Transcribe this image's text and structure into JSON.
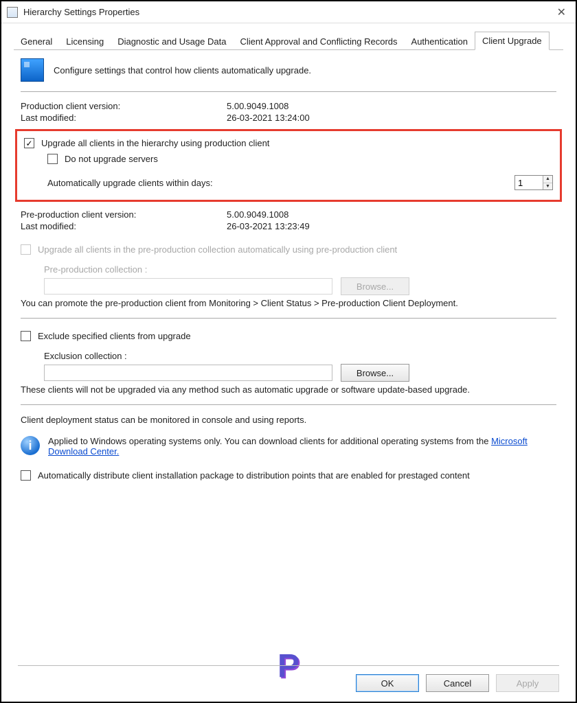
{
  "window": {
    "title": "Hierarchy Settings Properties",
    "close": "✕"
  },
  "tabs": {
    "items": [
      "General",
      "Licensing",
      "Diagnostic and Usage Data",
      "Client Approval and Conflicting Records",
      "Authentication",
      "Client Upgrade"
    ],
    "active": 5
  },
  "intro": "Configure settings that control how clients automatically upgrade.",
  "prod": {
    "version_label": "Production client version:",
    "version_value": "5.00.9049.1008",
    "modified_label": "Last modified:",
    "modified_value": "26-03-2021 13:24:00"
  },
  "upgrade": {
    "all_label": "Upgrade all clients in the hierarchy using production client",
    "all_checked": true,
    "noservers_label": "Do not upgrade servers",
    "noservers_checked": false,
    "days_label": "Automatically upgrade clients within days:",
    "days_value": "1"
  },
  "preprod": {
    "version_label": "Pre-production client version:",
    "version_value": "5.00.9049.1008",
    "modified_label": "Last modified:",
    "modified_value": "26-03-2021 13:23:49",
    "upgrade_label": "Upgrade all clients in the pre-production collection automatically using pre-production client",
    "collection_label": "Pre-production collection :",
    "browse_label": "Browse...",
    "promote_note": "You can promote the pre-production client from Monitoring > Client Status > Pre-production Client Deployment."
  },
  "exclude": {
    "checkbox_label": "Exclude specified clients from upgrade",
    "checked": false,
    "collection_label": "Exclusion collection :",
    "browse_label": "Browse...",
    "note": "These clients will not be upgraded via any method such as automatic upgrade or software update-based upgrade."
  },
  "deploy": {
    "status_note": "Client deployment status can be monitored in console and using reports.",
    "info_text_a": "Applied to Windows operating systems only. You can download clients for additional operating systems from the ",
    "info_link": "Microsoft Download Center.",
    "distribute_label": "Automatically distribute client installation package to distribution points that are enabled for prestaged content",
    "distribute_checked": false
  },
  "buttons": {
    "ok": "OK",
    "cancel": "Cancel",
    "apply": "Apply"
  },
  "watermark": "P"
}
